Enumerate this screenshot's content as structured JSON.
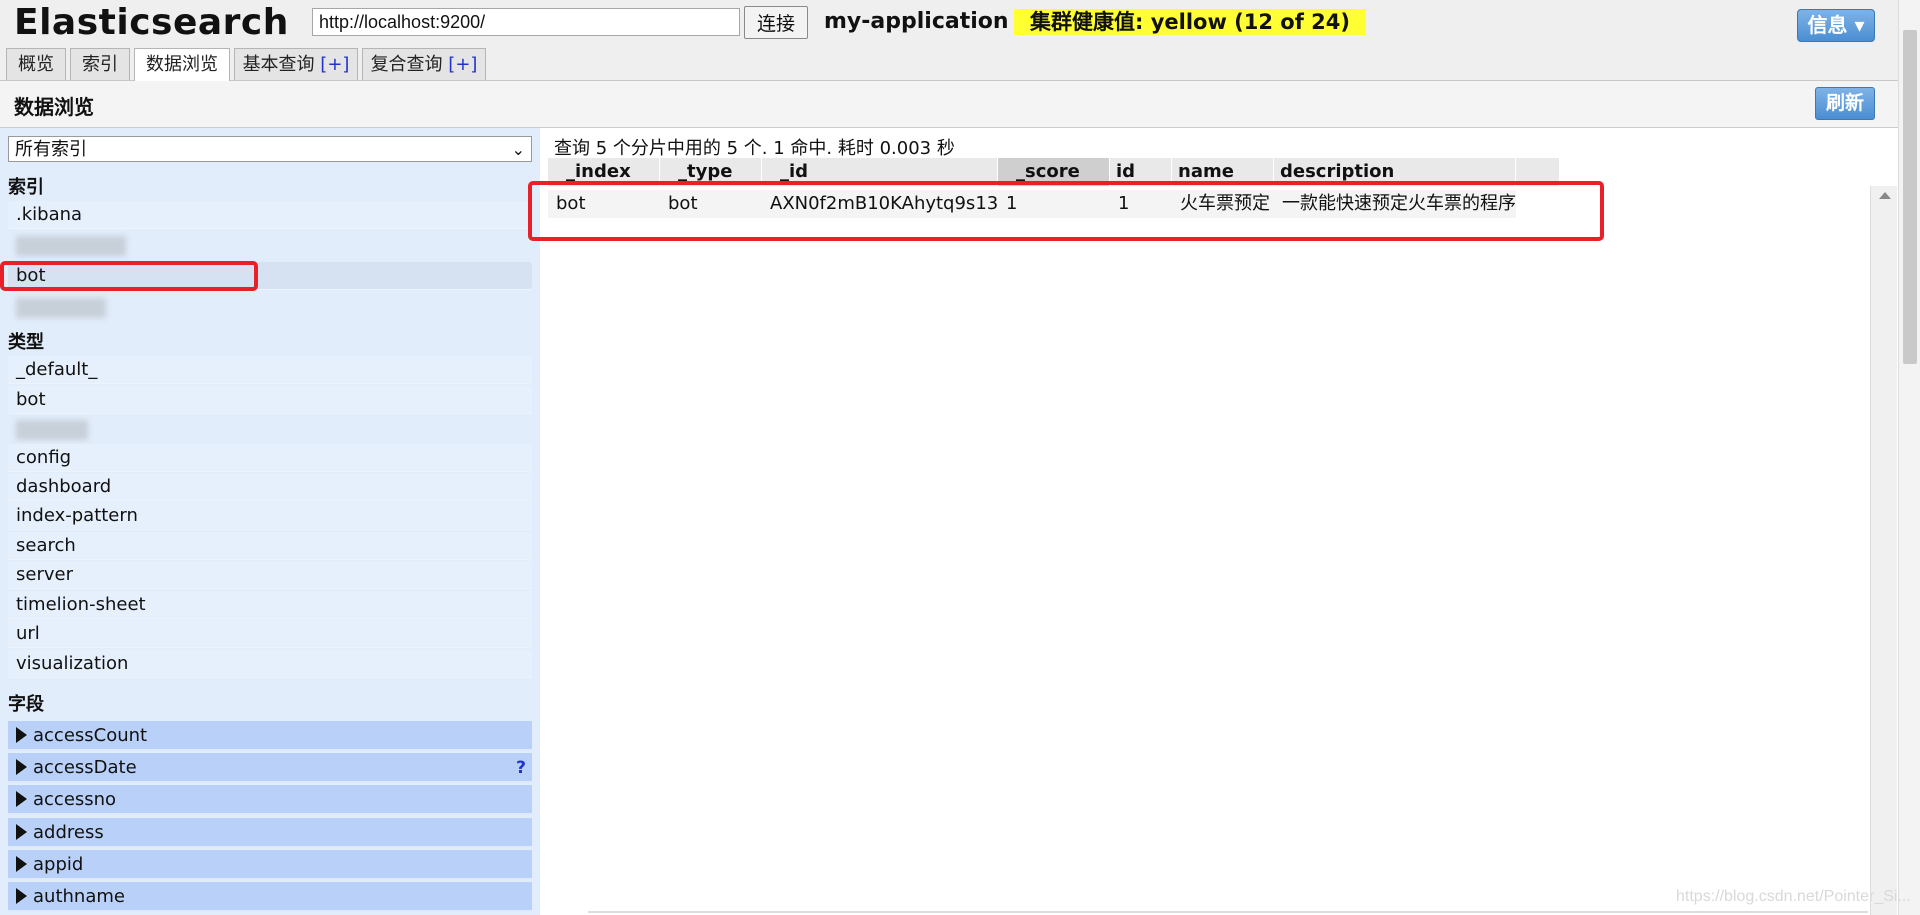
{
  "header": {
    "app_title": "Elasticsearch",
    "url_value": "http://localhost:9200/",
    "connect_label": "连接",
    "cluster_name": "my-application",
    "health_text": "集群健康值: yellow (12 of 24)",
    "info_label": "信息 ▾"
  },
  "tabs": [
    {
      "label": "概览"
    },
    {
      "label": "索引"
    },
    {
      "label": "数据浏览"
    },
    {
      "label": "基本查询",
      "plus": "[+]"
    },
    {
      "label": "复合查询",
      "plus": "[+]"
    }
  ],
  "subheader": {
    "title": "数据浏览",
    "refresh_label": "刷新"
  },
  "sidebar": {
    "index_select": "所有索引",
    "indices_label": "索引",
    "indices": [
      ".kibana",
      "bot"
    ],
    "types_label": "类型",
    "types": [
      "_default_",
      "bot",
      "config",
      "dashboard",
      "index-pattern",
      "search",
      "server",
      "timelion-sheet",
      "url",
      "visualization"
    ],
    "fields_label": "字段",
    "fields": [
      "accessCount",
      "accessDate",
      "accessno",
      "address",
      "appid",
      "authname"
    ],
    "help_icon": "?"
  },
  "results": {
    "summary": "查询 5 个分片中用的 5 个. 1 命中. 耗时 0.003 秒",
    "columns": [
      "_index",
      "_type",
      "_id",
      "_score",
      "id",
      "name",
      "description"
    ],
    "sort_indicator": "▲",
    "rows": [
      [
        "bot",
        "bot",
        "AXN0f2mB10KAhytq9s13",
        "1",
        "1",
        "火车票预定",
        "一款能快速预定火车票的程序"
      ]
    ]
  },
  "watermark": "https://blog.csdn.net/Pointer_Si..."
}
